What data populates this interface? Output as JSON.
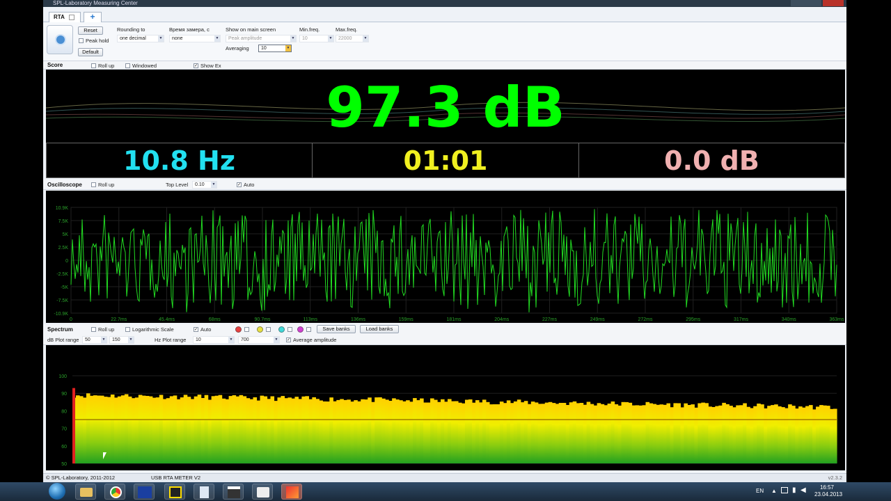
{
  "window": {
    "title": "SPL-Laboratory Measuring Center"
  },
  "tabs": [
    {
      "label": "RTA"
    },
    {
      "label": "+"
    }
  ],
  "toolbar": {
    "reset_label": "Reset",
    "peak_hold_label": "Peak hold",
    "default_label": "Default",
    "rounding_label": "Rounding to",
    "rounding_value": "one decimal",
    "time_label": "Время замера, с",
    "time_value": "none",
    "show_label": "Show on main screen",
    "show_value": "Peak amplitude",
    "averaging_label": "Averaging",
    "averaging_value": "10",
    "minfreq_label": "Min.freq.",
    "minfreq_value": "10",
    "maxfreq_label": "Max.freq.",
    "maxfreq_value": "22000"
  },
  "score": {
    "title": "Score",
    "rollup_label": "Roll up",
    "windowed_label": "Windowed",
    "showex_label": "Show Ex",
    "main_value": "97.3 dB",
    "main_color": "#00ff00",
    "freq_value": "10.8 Hz",
    "freq_color": "#22e0f0",
    "time_value": "01:01",
    "time_color": "#f0f020",
    "level_value": "0.0 dB",
    "level_color": "#f0b0b0"
  },
  "oscilloscope": {
    "title": "Oscilloscope",
    "rollup_label": "Roll up",
    "toplevel_label": "Top Level",
    "toplevel_value": "0.10",
    "auto_label": "Auto",
    "trace_color": "#22dd22",
    "y_ticks": [
      "10.9K",
      "7.5K",
      "5K",
      "2.5K",
      "0",
      "-2.5K",
      "-5K",
      "-7.5K",
      "-10.9K"
    ],
    "x_ticks": [
      "0",
      "22.7ms",
      "45.4ms",
      "68ms",
      "90.7ms",
      "113ms",
      "136ms",
      "159ms",
      "181ms",
      "204ms",
      "227ms",
      "249ms",
      "272ms",
      "295ms",
      "317ms",
      "340ms",
      "363ms"
    ]
  },
  "spectrum": {
    "title": "Spectrum",
    "rollup_label": "Roll up",
    "logscale_label": "Logarithmic Scale",
    "auto_label": "Auto",
    "save_banks_label": "Save banks",
    "load_banks_label": "Load banks",
    "db_range_label": "dB Plot range",
    "db_min": "50",
    "db_max": "150",
    "hz_range_label": "Hz Plot range",
    "hz_min": "10",
    "hz_max": "700",
    "avg_amp_label": "Average amplitude",
    "y_ticks": [
      "100",
      "90",
      "80",
      "70",
      "60",
      "50"
    ],
    "bank_colors": [
      "#e84040",
      "#e8e040",
      "#40d8d8",
      "#d040d0"
    ]
  },
  "status": {
    "copyright": "© SPL-Laboratory, 2011-2012",
    "device": "USB RTA METER V2",
    "version": "v2.3.2"
  },
  "taskbar": {
    "lang": "EN",
    "time": "16:57",
    "date": "23.04.2013"
  }
}
